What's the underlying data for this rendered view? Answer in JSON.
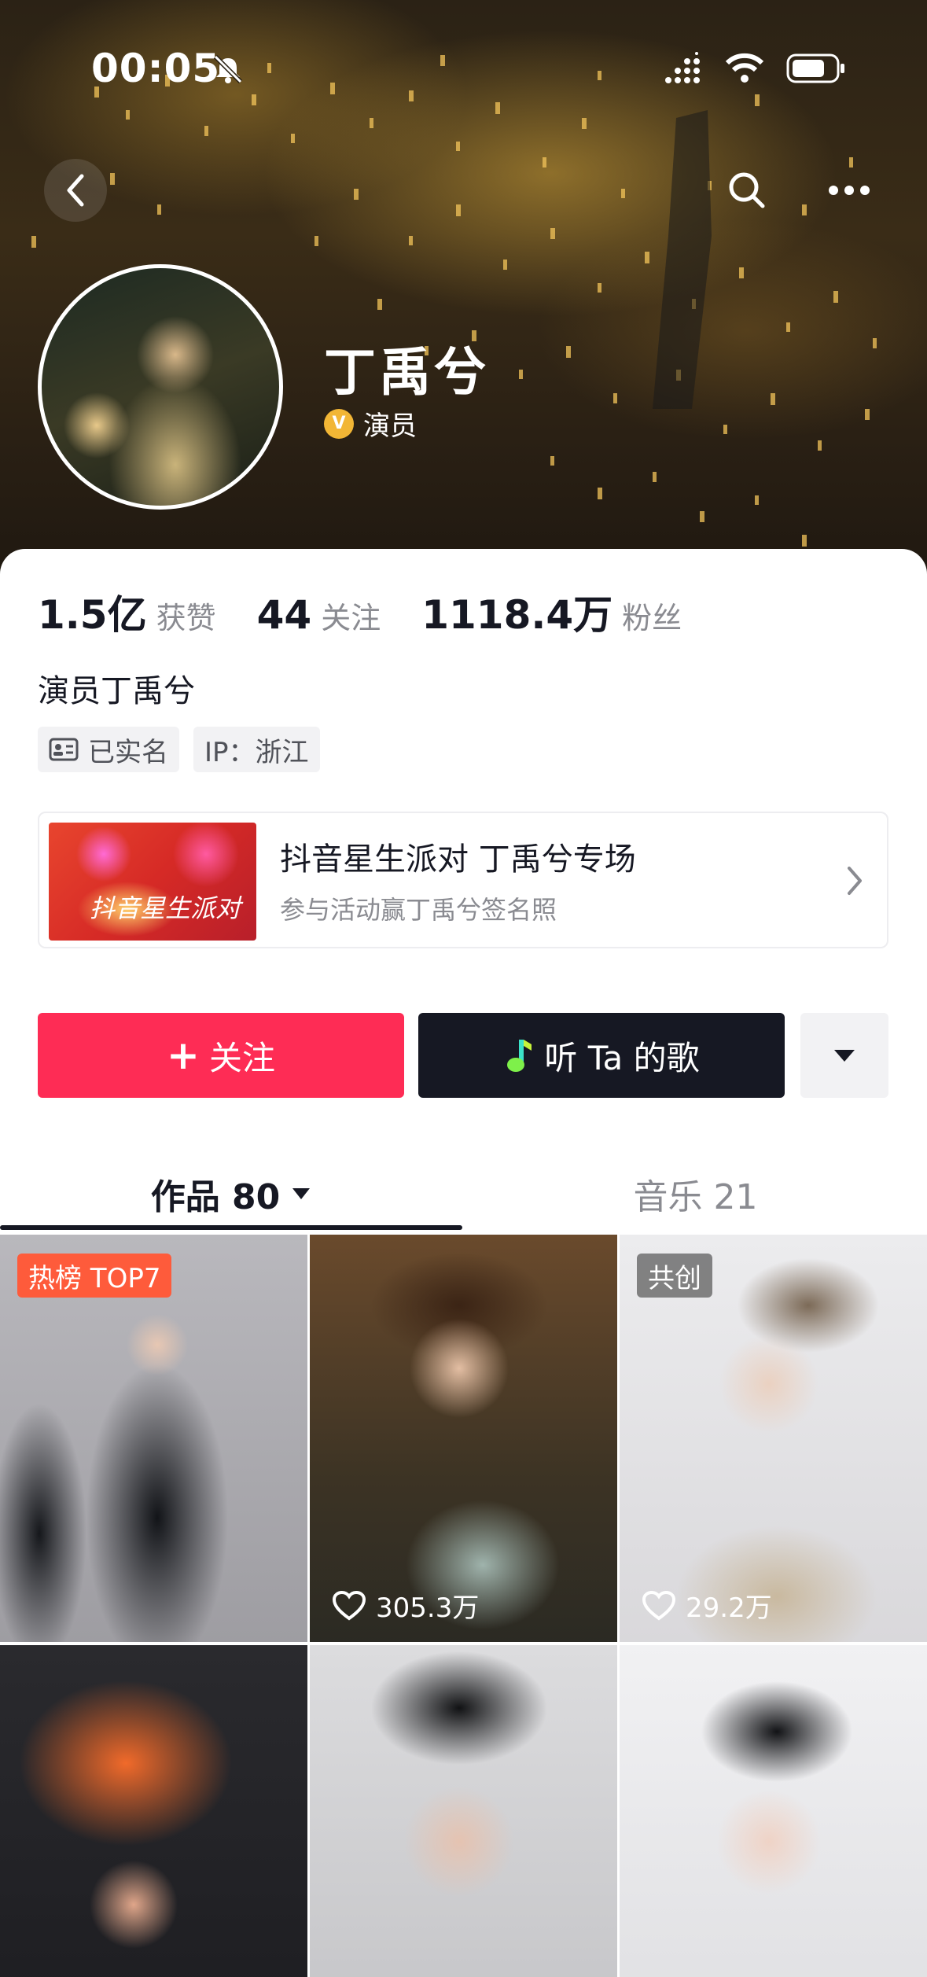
{
  "status_bar": {
    "time": "00:05"
  },
  "profile": {
    "name": "丁禹兮",
    "verify_badge": "V",
    "verify_label": "演员",
    "bio": "演员丁禹兮",
    "tags": [
      "已实名",
      "IP：浙江"
    ]
  },
  "stats": [
    {
      "value": "1.5亿",
      "label": "获赞"
    },
    {
      "value": "44",
      "label": "关注"
    },
    {
      "value": "1118.4万",
      "label": "粉丝"
    }
  ],
  "promo": {
    "thumb_text": "抖音星生派对",
    "title": "抖音星生派对 丁禹兮专场",
    "subtitle": "参与活动赢丁禹兮签名照"
  },
  "actions": {
    "follow_plus": "+",
    "follow_label": "关注",
    "music_label": "听 Ta 的歌"
  },
  "tabs": [
    {
      "label": "作品 80",
      "active": true
    },
    {
      "label": "音乐 21",
      "active": false
    }
  ],
  "videos": [
    {
      "badge": "热榜 TOP7",
      "likes": ""
    },
    {
      "badge": "",
      "likes": "305.3万"
    },
    {
      "badge": "共创",
      "likes": "29.2万"
    },
    {
      "badge": "",
      "likes": ""
    },
    {
      "badge": "",
      "likes": ""
    },
    {
      "badge": "",
      "likes": ""
    }
  ],
  "icons": [
    "back-icon",
    "search-icon",
    "more-icon",
    "mute-icon",
    "signal-icon",
    "wifi-icon",
    "battery-icon",
    "id-card-icon",
    "chevron-right-icon",
    "music-note-icon",
    "dropdown-icon",
    "heart-icon"
  ],
  "colors": {
    "accent": "#fe2c55",
    "dark_button": "#161823",
    "verify": "#f2b635",
    "hot_badge": "#fe5b3b"
  }
}
